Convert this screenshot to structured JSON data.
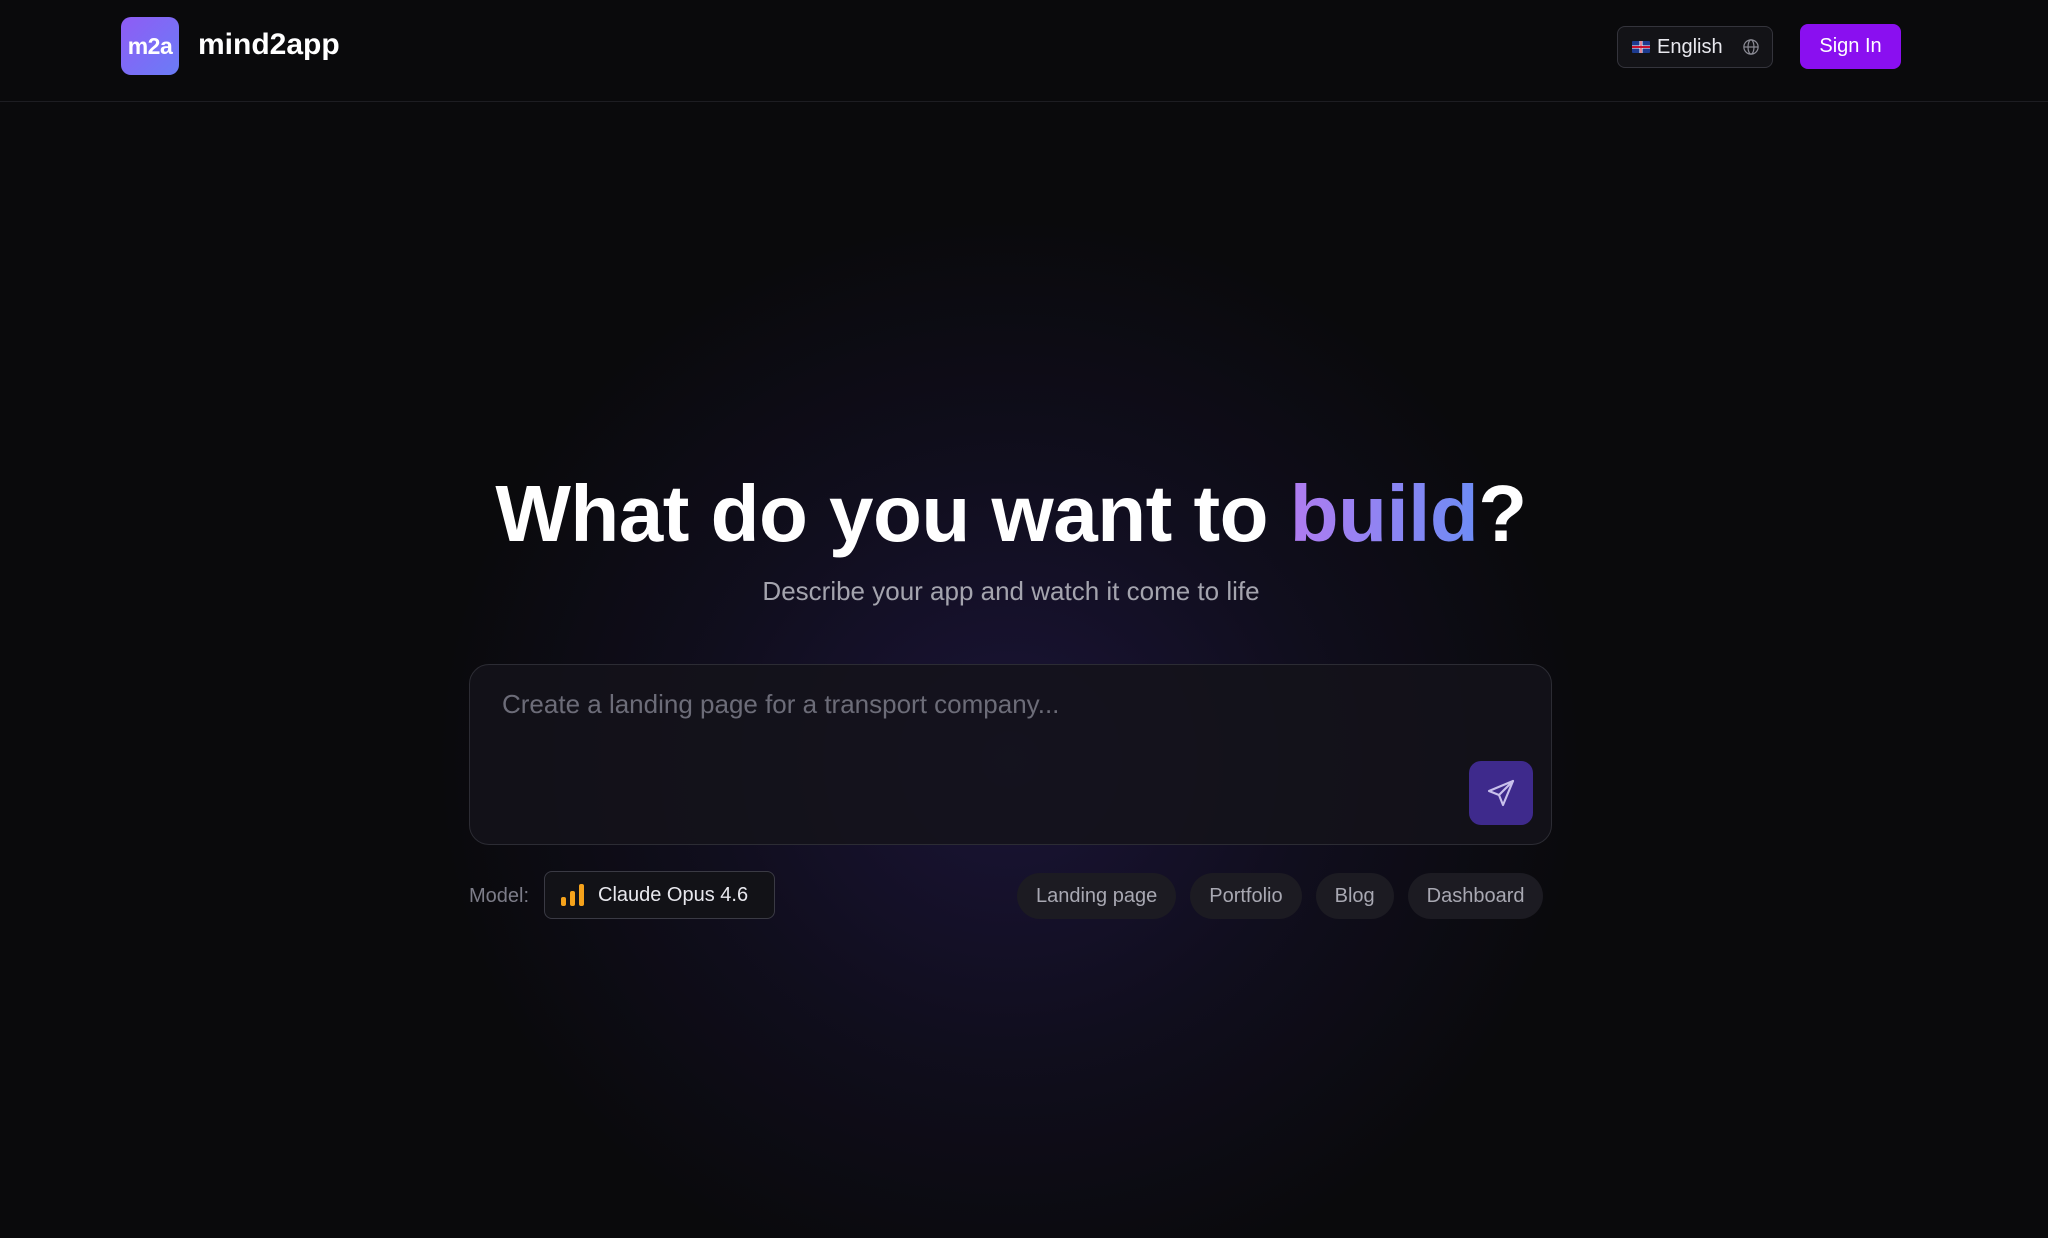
{
  "header": {
    "logo_text": "m2a",
    "brand": "mind2app",
    "language": "English",
    "signin_label": "Sign In"
  },
  "hero": {
    "headline_prefix": "What do you want to ",
    "headline_accent": "build",
    "headline_suffix": "?",
    "subtitle": "Describe your app and watch it come to life"
  },
  "prompt": {
    "placeholder": "Create a landing page for a transport company...",
    "value": ""
  },
  "model": {
    "label": "Model:",
    "selected": "Claude Opus 4.6"
  },
  "chips": [
    "Landing page",
    "Portfolio",
    "Blog",
    "Dashboard"
  ],
  "colors": {
    "accent_button": "#8a0ff0",
    "send_button": "#3e2a8c",
    "model_icon": "#f5a21b",
    "gradient_start": "#b07cf0",
    "gradient_end": "#6d8cf5"
  },
  "icons": {
    "language": "globe-icon",
    "flag": "uk-flag-icon",
    "send": "send-icon",
    "model": "signal-bars-icon"
  }
}
